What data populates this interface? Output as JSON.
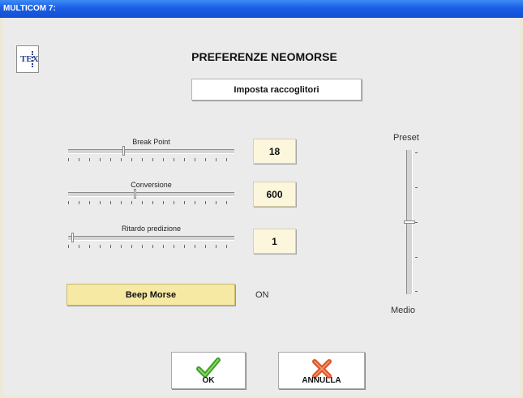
{
  "window": {
    "title": "MULTICOM 7:"
  },
  "header": {
    "title": "PREFERENZE NEOMORSE",
    "logo_text": "TEX"
  },
  "collectors_button": {
    "label": "Imposta raccoglitori"
  },
  "sliders": [
    {
      "label": "Break Point",
      "value": "18",
      "position": 0.33
    },
    {
      "label": "Conversione",
      "value": "600",
      "position": 0.4
    },
    {
      "label": "Ritardo predizione",
      "value": "1",
      "position": 0.02
    }
  ],
  "beep": {
    "label": "Beep Morse",
    "state": "ON"
  },
  "vertical_slider": {
    "top_label": "Preset",
    "bottom_label": "Medio",
    "position": 0.5
  },
  "actions": {
    "ok_label": "OK",
    "cancel_label": "ANNULLA"
  },
  "colors": {
    "titlebar": "#1a5ee6",
    "ok_icon": "#3aa12a",
    "cancel_icon": "#e0552a",
    "value_box": "#fbf6dc",
    "beep_button": "#f6e9a3"
  }
}
